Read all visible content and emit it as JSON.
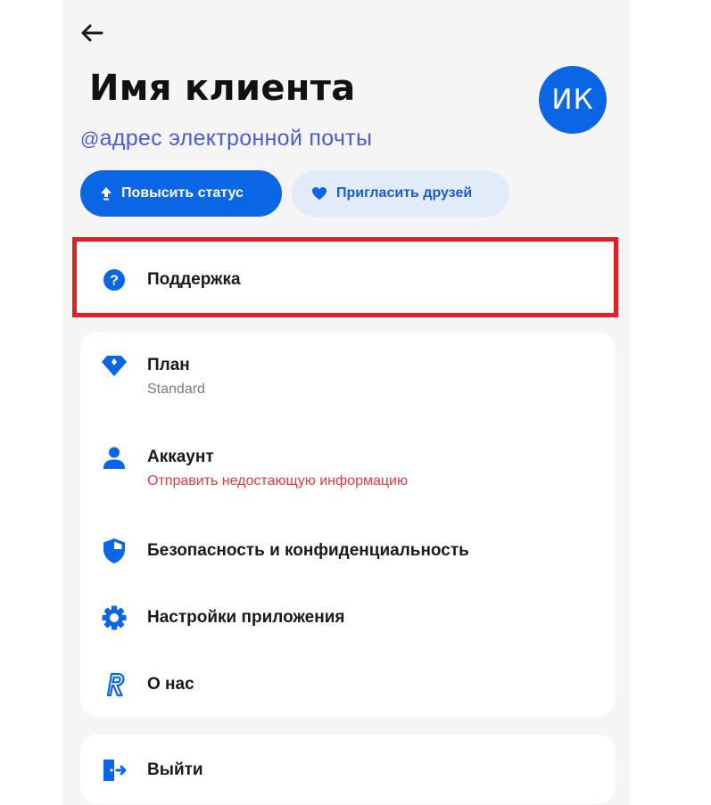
{
  "header": {
    "back_icon": "arrow-left-icon",
    "title": "Имя клиента",
    "email_prefix": "@",
    "email": "адрес электронной почты",
    "avatar_initials": "ИК"
  },
  "actions": {
    "upgrade_label": "Повысить статус",
    "upgrade_icon": "arrow-up-icon",
    "invite_label": "Пригласить друзей",
    "invite_icon": "heart-icon"
  },
  "support": {
    "label": "Поддержка",
    "icon": "question-circle-icon",
    "highlighted": true
  },
  "menu": {
    "items": [
      {
        "label": "План",
        "sub": "Standard",
        "icon": "diamond-icon"
      },
      {
        "label": "Аккаунт",
        "sub": "Отправить недостающую информацию",
        "icon": "person-icon"
      },
      {
        "label": "Безопасность и конфиденциальность",
        "icon": "shield-icon"
      },
      {
        "label": "Настройки приложения",
        "icon": "gear-icon"
      },
      {
        "label": "О нас",
        "icon": "r-logo-icon"
      }
    ]
  },
  "logout": {
    "label": "Выйти",
    "icon": "exit-icon"
  },
  "colors": {
    "accent": "#0a66e4",
    "accent_light": "#e2ebfa",
    "highlight_border": "#e01f27",
    "warning_text": "#e23d3d",
    "background": "#f5f5f5"
  }
}
